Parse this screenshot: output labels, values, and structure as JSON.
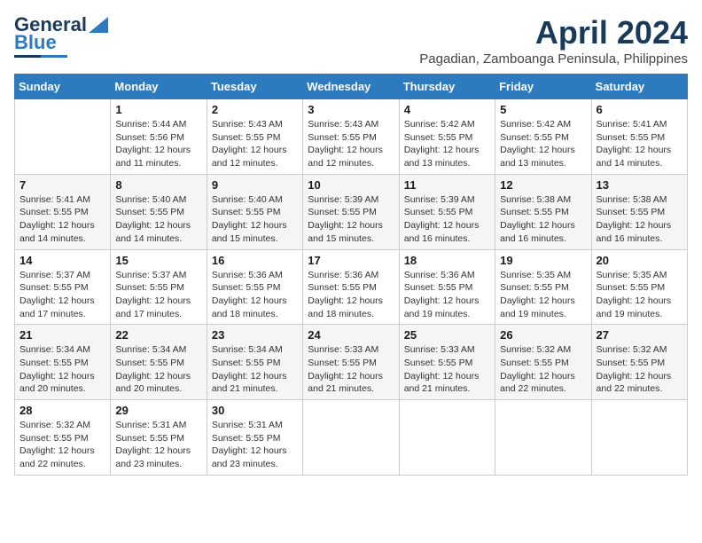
{
  "header": {
    "logo_line1": "General",
    "logo_line2": "Blue",
    "month": "April 2024",
    "location": "Pagadian, Zamboanga Peninsula, Philippines"
  },
  "weekdays": [
    "Sunday",
    "Monday",
    "Tuesday",
    "Wednesday",
    "Thursday",
    "Friday",
    "Saturday"
  ],
  "weeks": [
    [
      {
        "day": "",
        "detail": ""
      },
      {
        "day": "1",
        "detail": "Sunrise: 5:44 AM\nSunset: 5:56 PM\nDaylight: 12 hours\nand 11 minutes."
      },
      {
        "day": "2",
        "detail": "Sunrise: 5:43 AM\nSunset: 5:55 PM\nDaylight: 12 hours\nand 12 minutes."
      },
      {
        "day": "3",
        "detail": "Sunrise: 5:43 AM\nSunset: 5:55 PM\nDaylight: 12 hours\nand 12 minutes."
      },
      {
        "day": "4",
        "detail": "Sunrise: 5:42 AM\nSunset: 5:55 PM\nDaylight: 12 hours\nand 13 minutes."
      },
      {
        "day": "5",
        "detail": "Sunrise: 5:42 AM\nSunset: 5:55 PM\nDaylight: 12 hours\nand 13 minutes."
      },
      {
        "day": "6",
        "detail": "Sunrise: 5:41 AM\nSunset: 5:55 PM\nDaylight: 12 hours\nand 14 minutes."
      }
    ],
    [
      {
        "day": "7",
        "detail": "Sunrise: 5:41 AM\nSunset: 5:55 PM\nDaylight: 12 hours\nand 14 minutes."
      },
      {
        "day": "8",
        "detail": "Sunrise: 5:40 AM\nSunset: 5:55 PM\nDaylight: 12 hours\nand 14 minutes."
      },
      {
        "day": "9",
        "detail": "Sunrise: 5:40 AM\nSunset: 5:55 PM\nDaylight: 12 hours\nand 15 minutes."
      },
      {
        "day": "10",
        "detail": "Sunrise: 5:39 AM\nSunset: 5:55 PM\nDaylight: 12 hours\nand 15 minutes."
      },
      {
        "day": "11",
        "detail": "Sunrise: 5:39 AM\nSunset: 5:55 PM\nDaylight: 12 hours\nand 16 minutes."
      },
      {
        "day": "12",
        "detail": "Sunrise: 5:38 AM\nSunset: 5:55 PM\nDaylight: 12 hours\nand 16 minutes."
      },
      {
        "day": "13",
        "detail": "Sunrise: 5:38 AM\nSunset: 5:55 PM\nDaylight: 12 hours\nand 16 minutes."
      }
    ],
    [
      {
        "day": "14",
        "detail": "Sunrise: 5:37 AM\nSunset: 5:55 PM\nDaylight: 12 hours\nand 17 minutes."
      },
      {
        "day": "15",
        "detail": "Sunrise: 5:37 AM\nSunset: 5:55 PM\nDaylight: 12 hours\nand 17 minutes."
      },
      {
        "day": "16",
        "detail": "Sunrise: 5:36 AM\nSunset: 5:55 PM\nDaylight: 12 hours\nand 18 minutes."
      },
      {
        "day": "17",
        "detail": "Sunrise: 5:36 AM\nSunset: 5:55 PM\nDaylight: 12 hours\nand 18 minutes."
      },
      {
        "day": "18",
        "detail": "Sunrise: 5:36 AM\nSunset: 5:55 PM\nDaylight: 12 hours\nand 19 minutes."
      },
      {
        "day": "19",
        "detail": "Sunrise: 5:35 AM\nSunset: 5:55 PM\nDaylight: 12 hours\nand 19 minutes."
      },
      {
        "day": "20",
        "detail": "Sunrise: 5:35 AM\nSunset: 5:55 PM\nDaylight: 12 hours\nand 19 minutes."
      }
    ],
    [
      {
        "day": "21",
        "detail": "Sunrise: 5:34 AM\nSunset: 5:55 PM\nDaylight: 12 hours\nand 20 minutes."
      },
      {
        "day": "22",
        "detail": "Sunrise: 5:34 AM\nSunset: 5:55 PM\nDaylight: 12 hours\nand 20 minutes."
      },
      {
        "day": "23",
        "detail": "Sunrise: 5:34 AM\nSunset: 5:55 PM\nDaylight: 12 hours\nand 21 minutes."
      },
      {
        "day": "24",
        "detail": "Sunrise: 5:33 AM\nSunset: 5:55 PM\nDaylight: 12 hours\nand 21 minutes."
      },
      {
        "day": "25",
        "detail": "Sunrise: 5:33 AM\nSunset: 5:55 PM\nDaylight: 12 hours\nand 21 minutes."
      },
      {
        "day": "26",
        "detail": "Sunrise: 5:32 AM\nSunset: 5:55 PM\nDaylight: 12 hours\nand 22 minutes."
      },
      {
        "day": "27",
        "detail": "Sunrise: 5:32 AM\nSunset: 5:55 PM\nDaylight: 12 hours\nand 22 minutes."
      }
    ],
    [
      {
        "day": "28",
        "detail": "Sunrise: 5:32 AM\nSunset: 5:55 PM\nDaylight: 12 hours\nand 22 minutes."
      },
      {
        "day": "29",
        "detail": "Sunrise: 5:31 AM\nSunset: 5:55 PM\nDaylight: 12 hours\nand 23 minutes."
      },
      {
        "day": "30",
        "detail": "Sunrise: 5:31 AM\nSunset: 5:55 PM\nDaylight: 12 hours\nand 23 minutes."
      },
      {
        "day": "",
        "detail": ""
      },
      {
        "day": "",
        "detail": ""
      },
      {
        "day": "",
        "detail": ""
      },
      {
        "day": "",
        "detail": ""
      }
    ]
  ]
}
